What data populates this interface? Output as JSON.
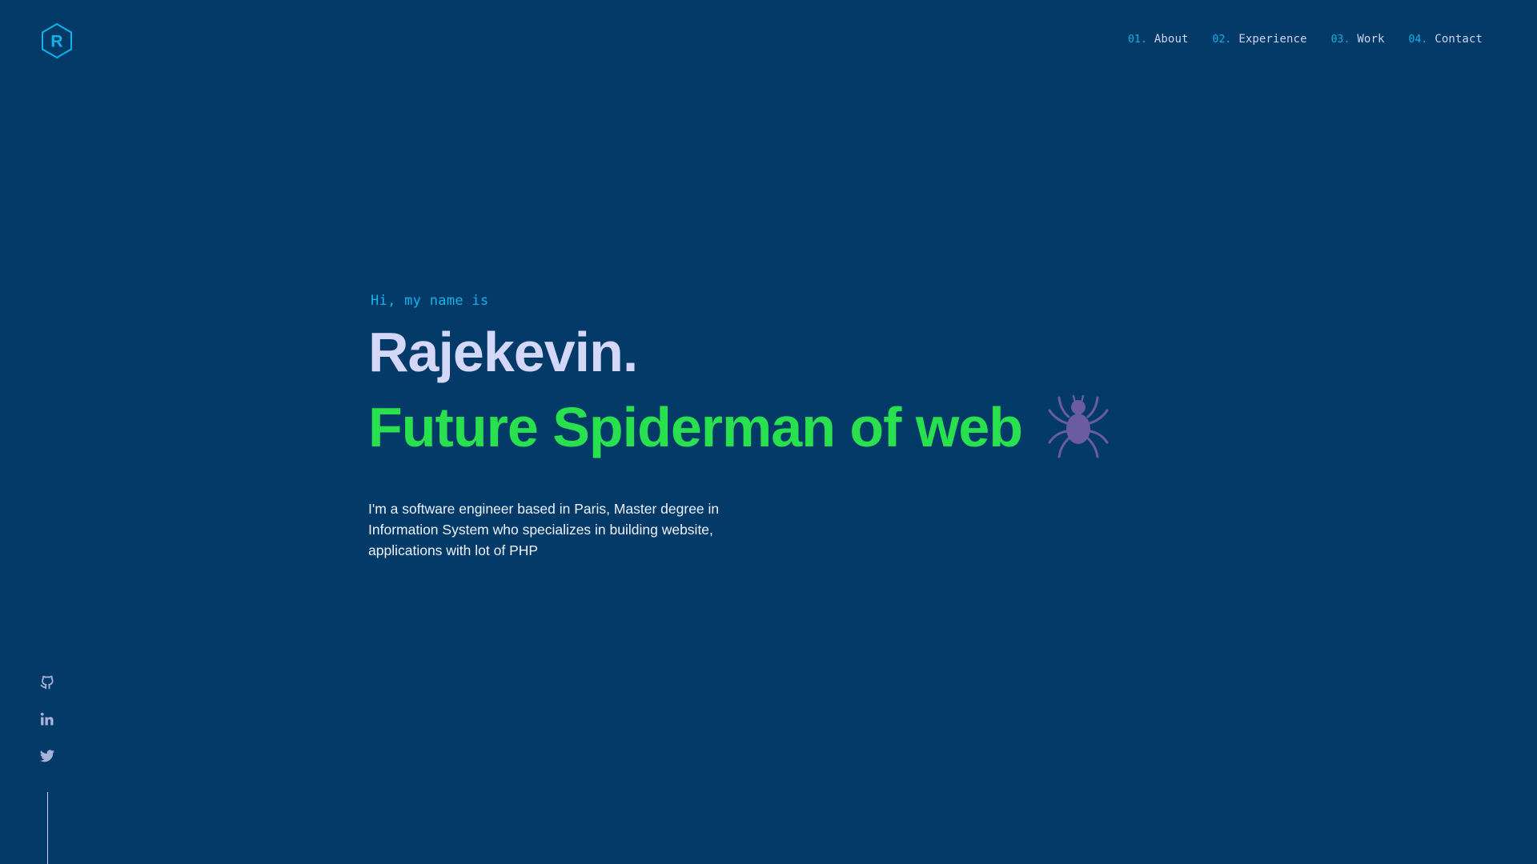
{
  "logo": {
    "letter": "R",
    "icon": "hexagon-logo-icon"
  },
  "nav": {
    "items": [
      {
        "num": "01.",
        "label": "About"
      },
      {
        "num": "02.",
        "label": "Experience"
      },
      {
        "num": "03.",
        "label": "Work"
      },
      {
        "num": "04.",
        "label": "Contact"
      }
    ]
  },
  "hero": {
    "greeting": "Hi, my name is",
    "name": "Rajekevin.",
    "tagline": "Future Spiderman of web",
    "tagline_icon": "spider-icon",
    "bio": "I'm a software engineer based in Paris, Master degree in Information System who specializes in building website, applications with lot of PHP"
  },
  "social": {
    "items": [
      {
        "icon": "github-icon"
      },
      {
        "icon": "linkedin-icon"
      },
      {
        "icon": "twitter-icon"
      }
    ]
  },
  "colors": {
    "background": "#033a68",
    "accent": "#10b3e9",
    "name": "#d4d7f7",
    "tagline": "#29e04e",
    "spider": "#6b5ca0",
    "text": "#eef3ff"
  }
}
